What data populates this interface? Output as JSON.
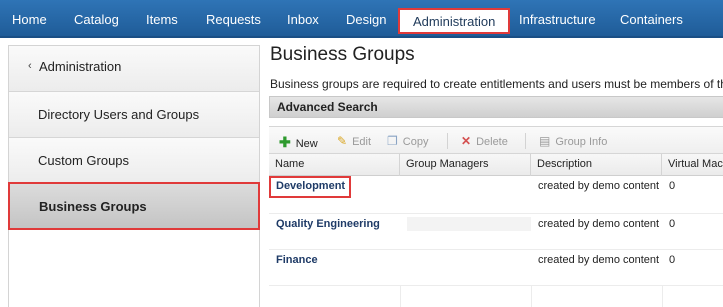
{
  "nav": {
    "items": [
      "Home",
      "Catalog",
      "Items",
      "Requests",
      "Inbox",
      "Design",
      "Administration",
      "Infrastructure",
      "Containers"
    ],
    "active": "Administration"
  },
  "sidebar": {
    "back_label": "Administration",
    "items": [
      "Directory Users and Groups",
      "Custom Groups",
      "Business Groups"
    ],
    "active": "Business Groups"
  },
  "main": {
    "title": "Business Groups",
    "description": "Business groups are required to create entitlements and users must be members of th",
    "advanced_search": "Advanced Search",
    "toolbar": {
      "new": "New",
      "edit": "Edit",
      "copy": "Copy",
      "delete": "Delete",
      "group_info": "Group Info"
    },
    "columns": [
      "Name",
      "Group Managers",
      "Description",
      "Virtual Mac"
    ],
    "rows": [
      {
        "name": "Development",
        "managers": "",
        "description": "created by demo content",
        "vms": "0"
      },
      {
        "name": "Quality Engineering",
        "managers": "",
        "description": "created by demo content",
        "vms": "0"
      },
      {
        "name": "Finance",
        "managers": "",
        "description": "created by demo content",
        "vms": "0"
      }
    ]
  },
  "colors": {
    "nav_bg": "#2a6aab",
    "highlight": "#e03a3a",
    "link": "#1f3b67"
  }
}
